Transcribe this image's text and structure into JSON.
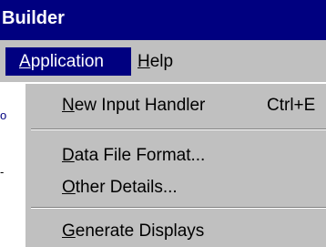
{
  "window": {
    "title": "Builder"
  },
  "menubar": {
    "items": [
      {
        "mnemonic": "A",
        "rest": "pplication"
      },
      {
        "mnemonic": "H",
        "rest": "elp"
      }
    ]
  },
  "background": {
    "fragment_1": "o",
    "fragment_2": "-"
  },
  "dropdown": {
    "items": [
      {
        "mnemonic": "N",
        "rest": "ew Input Handler",
        "shortcut": "Ctrl+E"
      },
      {
        "mnemonic": "D",
        "rest": "ata File Format..."
      },
      {
        "mnemonic": "O",
        "rest": "ther Details..."
      },
      {
        "mnemonic": "G",
        "rest": "enerate Displays"
      }
    ]
  }
}
